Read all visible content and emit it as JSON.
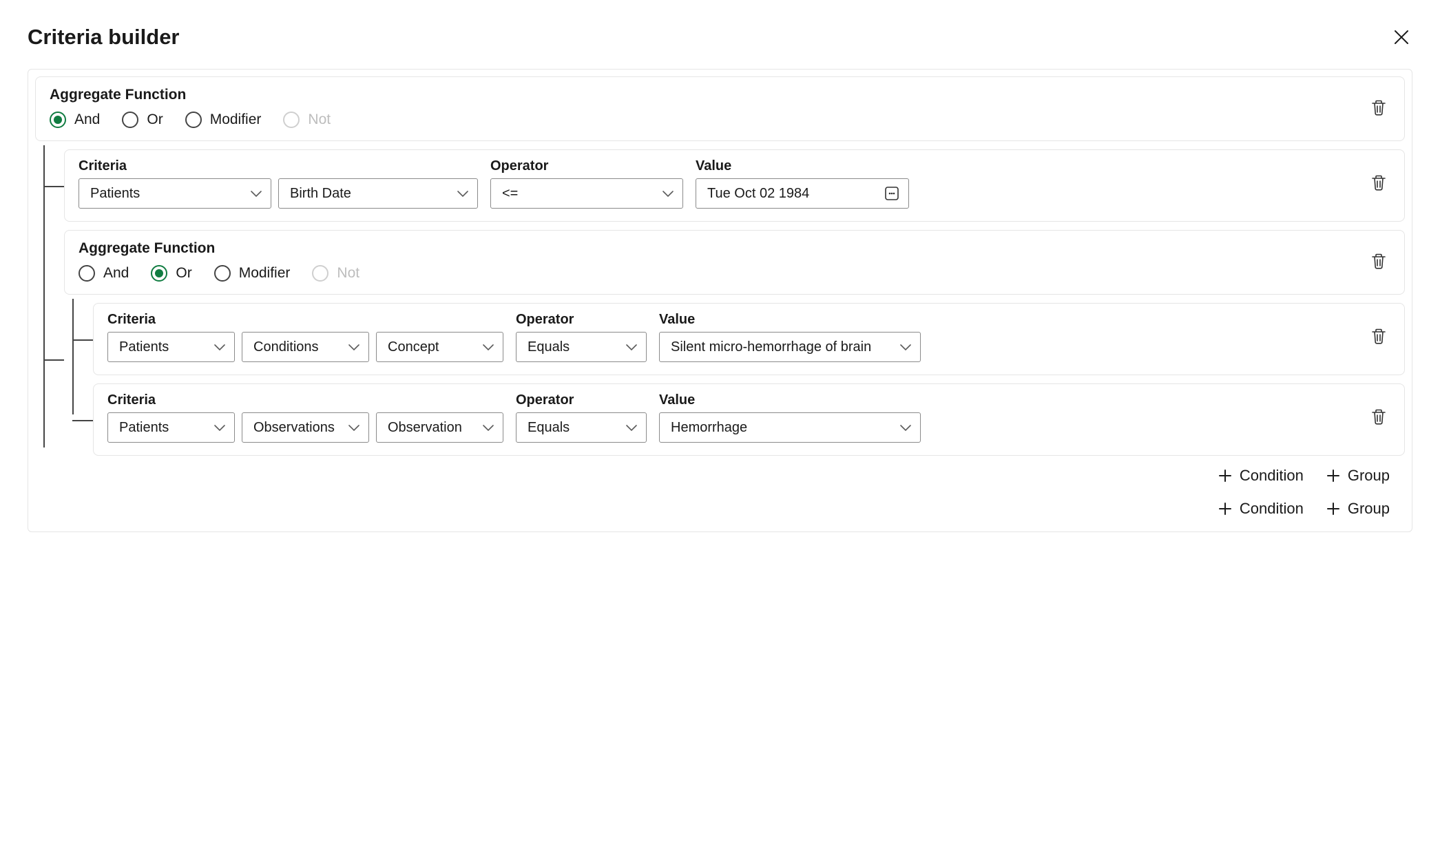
{
  "title": "Criteria builder",
  "labels": {
    "aggregate_function": "Aggregate Function",
    "criteria": "Criteria",
    "operator": "Operator",
    "value": "Value",
    "add_condition": "Condition",
    "add_group": "Group"
  },
  "radio_options": {
    "and": "And",
    "or": "Or",
    "modifier": "Modifier",
    "not": "Not"
  },
  "root": {
    "selected": "and",
    "not_disabled": true,
    "children": [
      {
        "type": "condition",
        "criteria": [
          "Patients",
          "Birth Date"
        ],
        "operator": "<=",
        "value": "Tue Oct 02 1984",
        "value_kind": "date"
      },
      {
        "type": "group",
        "selected": "or",
        "not_disabled": true,
        "children": [
          {
            "type": "condition",
            "criteria": [
              "Patients",
              "Conditions",
              "Concept"
            ],
            "operator": "Equals",
            "value": "Silent micro-hemorrhage of brain",
            "value_kind": "select"
          },
          {
            "type": "condition",
            "criteria": [
              "Patients",
              "Observations",
              "Observation"
            ],
            "operator": "Equals",
            "value": "Hemorrhage",
            "value_kind": "select"
          }
        ]
      }
    ]
  }
}
